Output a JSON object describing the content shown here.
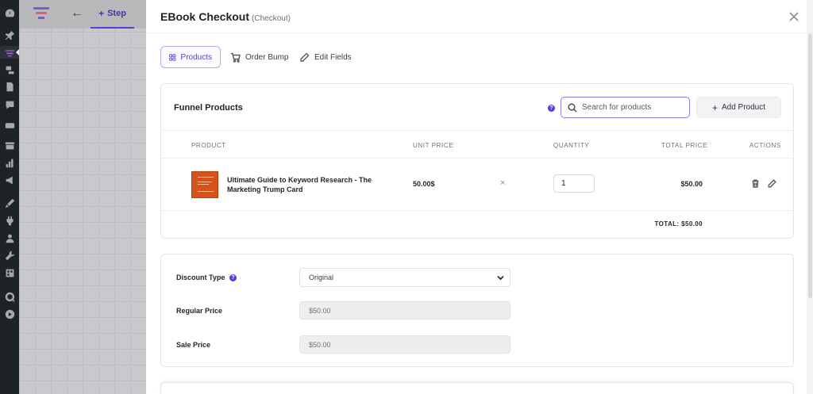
{
  "topbar": {
    "step_label": "Step"
  },
  "modal": {
    "title": "EBook Checkout",
    "subtitle": "(Checkout)"
  },
  "tabs": [
    {
      "label": "Products",
      "icon": "grid-icon",
      "active": true
    },
    {
      "label": "Order Bump",
      "icon": "cart-icon",
      "active": false
    },
    {
      "label": "Edit Fields",
      "icon": "pencil-icon",
      "active": false
    }
  ],
  "products": {
    "title": "Funnel Products",
    "search_placeholder": "Search for products",
    "add_label": "Add Product",
    "columns": [
      "PRODUCT",
      "UNIT PRICE",
      "QUANTITY",
      "TOTAL PRICE",
      "ACTIONS"
    ],
    "rows": [
      {
        "name": "Ultimate Guide to Keyword Research - The Marketing Trump Card",
        "unit_price": "50.00$",
        "times": "×",
        "quantity": "1",
        "total": "$50.00"
      }
    ],
    "grand_total": "TOTAL: $50.00"
  },
  "discount": {
    "type_label": "Discount Type",
    "type_value": "Original",
    "regular_label": "Regular Price",
    "regular_value": "$50.00",
    "sale_label": "Sale Price",
    "sale_value": "$50.00"
  },
  "colors": {
    "accent": "#5b3fd0",
    "sidebar": "#1d2327",
    "product_thumb": "#d4531c"
  }
}
